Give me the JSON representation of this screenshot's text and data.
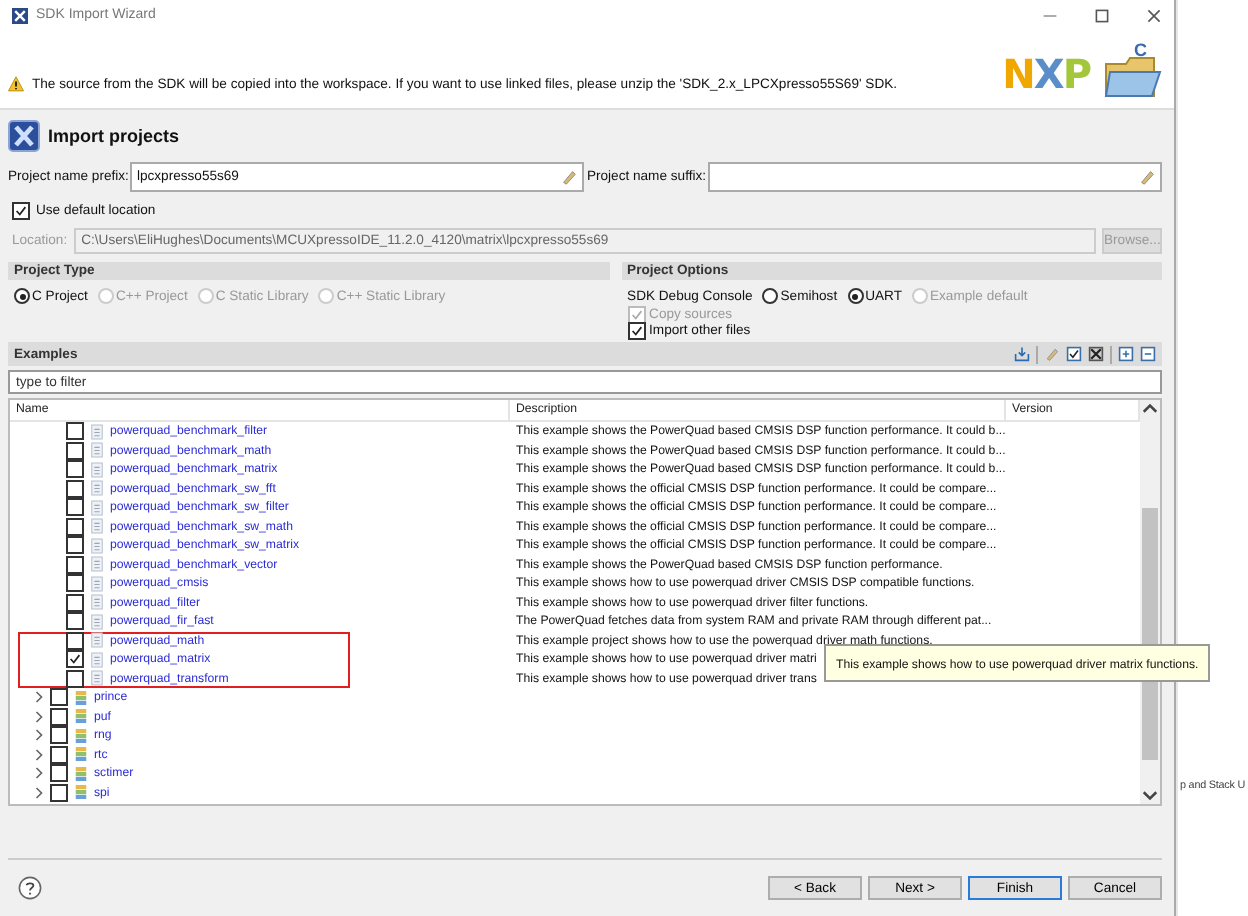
{
  "window": {
    "title": "SDK Import Wizard"
  },
  "warning": "The source from the SDK will be copied into the workspace. If you want to use linked files, please unzip the 'SDK_2.x_LPCXpresso55S69' SDK.",
  "logo": {
    "text": "NXP",
    "folder_badge": "C"
  },
  "header": {
    "title": "Import projects"
  },
  "prefix": {
    "label": "Project name prefix:",
    "value": "lpcxpresso55s69"
  },
  "suffix": {
    "label": "Project name suffix:"
  },
  "use_default_location": {
    "label": "Use default location",
    "checked": true
  },
  "location": {
    "label": "Location:",
    "value": "C:\\Users\\EliHughes\\Documents\\MCUXpressoIDE_11.2.0_4120\\matrix\\lpcxpresso55s69",
    "browse": "Browse...",
    "disabled": true
  },
  "project_type": {
    "title": "Project Type",
    "options": [
      {
        "label": "C Project",
        "selected": true
      },
      {
        "label": "C++ Project",
        "selected": false
      },
      {
        "label": "C Static Library",
        "selected": false
      },
      {
        "label": "C++ Static Library",
        "selected": false
      }
    ]
  },
  "project_options": {
    "title": "Project Options",
    "console_label": "SDK Debug Console",
    "console_options": [
      {
        "label": "Semihost",
        "selected": false,
        "disabled": false
      },
      {
        "label": "UART",
        "selected": true,
        "disabled": false
      },
      {
        "label": "Example default",
        "selected": false,
        "disabled": true
      }
    ],
    "checks": [
      {
        "label": "Copy sources",
        "checked": true,
        "disabled": true
      },
      {
        "label": "Import other files",
        "checked": true,
        "disabled": false
      }
    ]
  },
  "examples": {
    "title": "Examples",
    "filter_placeholder": "type to filter",
    "columns": [
      "Name",
      "Description",
      "Version"
    ],
    "rows": [
      {
        "kind": "example",
        "name": "powerquad_benchmark_filter",
        "description": "This example shows the PowerQuad based CMSIS DSP function performance. It could b...",
        "checked": false,
        "highlighted": false
      },
      {
        "kind": "example",
        "name": "powerquad_benchmark_math",
        "description": "This example shows the PowerQuad based CMSIS DSP function performance. It could b...",
        "checked": false,
        "highlighted": false
      },
      {
        "kind": "example",
        "name": "powerquad_benchmark_matrix",
        "description": "This example shows the PowerQuad based CMSIS DSP function performance. It could b...",
        "checked": false,
        "highlighted": false
      },
      {
        "kind": "example",
        "name": "powerquad_benchmark_sw_fft",
        "description": "This example shows the official CMSIS DSP function performance. It could be compare...",
        "checked": false,
        "highlighted": false
      },
      {
        "kind": "example",
        "name": "powerquad_benchmark_sw_filter",
        "description": "This example shows the official CMSIS DSP function performance. It could be compare...",
        "checked": false,
        "highlighted": false
      },
      {
        "kind": "example",
        "name": "powerquad_benchmark_sw_math",
        "description": "This example shows the official CMSIS DSP function performance. It could be compare...",
        "checked": false,
        "highlighted": false
      },
      {
        "kind": "example",
        "name": "powerquad_benchmark_sw_matrix",
        "description": "This example shows the official CMSIS DSP function performance. It could be compare...",
        "checked": false,
        "highlighted": false
      },
      {
        "kind": "example",
        "name": "powerquad_benchmark_vector",
        "description": "This example shows the PowerQuad based CMSIS DSP function performance.",
        "checked": false,
        "highlighted": false
      },
      {
        "kind": "example",
        "name": "powerquad_cmsis",
        "description": "This example shows how to use powerquad driver CMSIS DSP compatible functions.",
        "checked": false,
        "highlighted": false
      },
      {
        "kind": "example",
        "name": "powerquad_filter",
        "description": "This example shows how to use powerquad driver filter functions.",
        "checked": false,
        "highlighted": false
      },
      {
        "kind": "example",
        "name": "powerquad_fir_fast",
        "description": "The PowerQuad fetches data from system RAM and private RAM through different pat...",
        "checked": false,
        "highlighted": false
      },
      {
        "kind": "example",
        "name": "powerquad_math",
        "description": "This example project shows how to use the powerquad driver math functions.",
        "checked": false,
        "highlighted": true
      },
      {
        "kind": "example",
        "name": "powerquad_matrix",
        "description": "This example shows how to use powerquad driver matri",
        "checked": true,
        "highlighted": true
      },
      {
        "kind": "example",
        "name": "powerquad_transform",
        "description": "This example shows how to use powerquad driver trans",
        "checked": false,
        "highlighted": true
      },
      {
        "kind": "group",
        "name": "prince",
        "checked": false,
        "expanded": false
      },
      {
        "kind": "group",
        "name": "puf",
        "checked": false,
        "expanded": false
      },
      {
        "kind": "group",
        "name": "rng",
        "checked": false,
        "expanded": false
      },
      {
        "kind": "group",
        "name": "rtc",
        "checked": false,
        "expanded": false
      },
      {
        "kind": "group",
        "name": "sctimer",
        "checked": false,
        "expanded": false
      },
      {
        "kind": "group",
        "name": "spi",
        "checked": false,
        "expanded": false
      }
    ]
  },
  "tooltip": "This example shows how to use powerquad driver matrix functions.",
  "buttons": [
    {
      "label": "< Back",
      "default": false
    },
    {
      "label": "Next >",
      "default": false
    },
    {
      "label": "Finish",
      "default": true
    },
    {
      "label": "Cancel",
      "default": false
    }
  ],
  "background_window": {
    "text": "p and Stack U"
  }
}
